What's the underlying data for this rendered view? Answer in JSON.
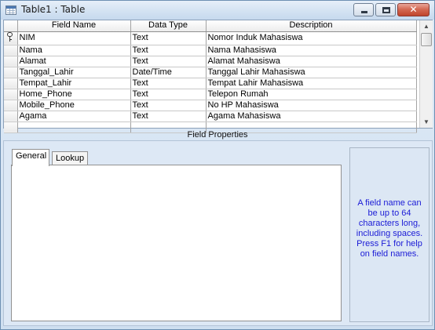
{
  "window": {
    "title": "Table1 : Table",
    "controls": {
      "close_glyph": "✕"
    }
  },
  "grid": {
    "columns": [
      "Field Name",
      "Data Type",
      "Description"
    ],
    "rows": [
      {
        "key": true,
        "name": "NIM",
        "type": "Text",
        "desc": "Nomor Induk Mahasiswa"
      },
      {
        "name": "Nama",
        "type": "Text",
        "desc": "Nama Mahasiswa"
      },
      {
        "name": "Alamat",
        "type": "Text",
        "desc": "Alamat Mahasiswa"
      },
      {
        "name": "Tanggal_Lahir",
        "type": "Date/Time",
        "desc": "Tanggal Lahir Mahasiswa"
      },
      {
        "name": "Tempat_Lahir",
        "type": "Text",
        "desc": "Tempat Lahir Mahasiswa"
      },
      {
        "name": "Home_Phone",
        "type": "Text",
        "desc": "Telepon Rumah"
      },
      {
        "name": "Mobile_Phone",
        "type": "Text",
        "desc": "No HP Mahasiswa"
      },
      {
        "name": "Agama",
        "type": "Text",
        "desc": "Agama Mahasiswa"
      },
      {
        "name": "",
        "type": "",
        "desc": ""
      }
    ]
  },
  "field_properties": {
    "label": "Field Properties",
    "tabs": [
      "General",
      "Lookup"
    ],
    "help_text": "A field name can be up to 64 characters long, including spaces.  Press F1 for help on field names."
  },
  "colors": {
    "help_text": "#1b1bd6",
    "panel_bg": "#dde8f5",
    "close_button": "#c0452c"
  },
  "icons": [
    "table-icon",
    "minimize-icon",
    "maximize-icon",
    "close-icon",
    "primary-key-icon",
    "scroll-up-arrow-icon",
    "scroll-down-arrow-icon"
  ]
}
